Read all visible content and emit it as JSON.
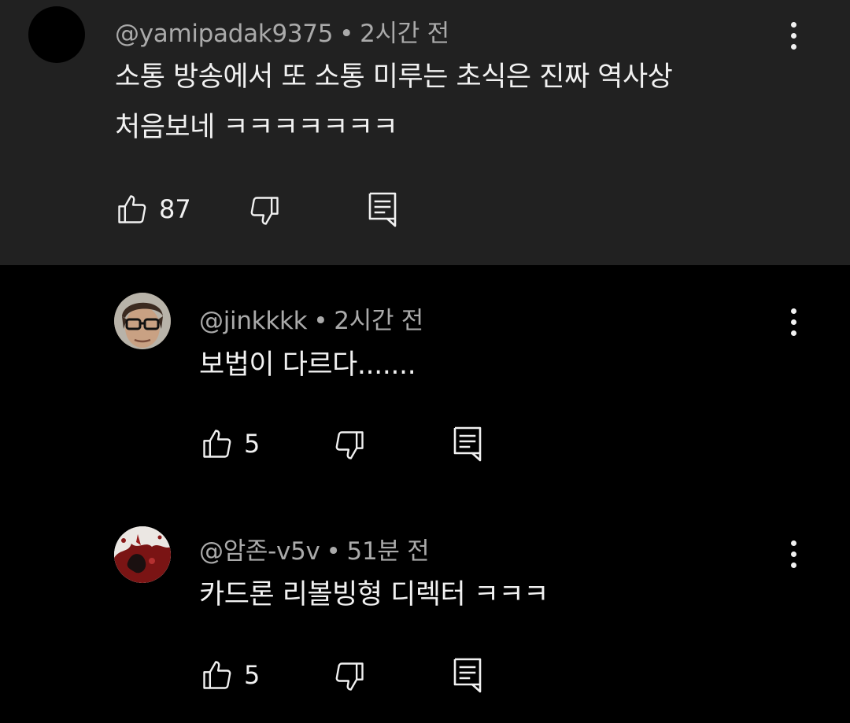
{
  "comments": [
    {
      "author": "@yamipadak9375",
      "separator": "•",
      "time": "2시간 전",
      "text_line1": "소통 방송에서 또 소통 미루는 초식은 진짜 역사상",
      "text_line2": "처음보네 ㅋㅋㅋㅋㅋㅋㅋ",
      "likes": "87",
      "highlighted": true
    },
    {
      "author": "@jinkkkk",
      "separator": "•",
      "time": "2시간 전",
      "text_line1": "보법이 다르다.......",
      "likes": "5"
    },
    {
      "author": "@암존-v5v",
      "separator": "•",
      "time": "51분 전",
      "text_line1": "카드론 리볼빙형 디렉터 ㅋㅋㅋ",
      "likes": "5"
    }
  ],
  "icons": {
    "like": "thumbs-up-icon",
    "dislike": "thumbs-down-icon",
    "reply": "reply-icon",
    "menu": "more-vertical-icon"
  },
  "colors": {
    "highlight_bg": "#212121",
    "page_bg": "#000000",
    "text": "#f1f1f1",
    "meta": "#aaaaaa"
  }
}
